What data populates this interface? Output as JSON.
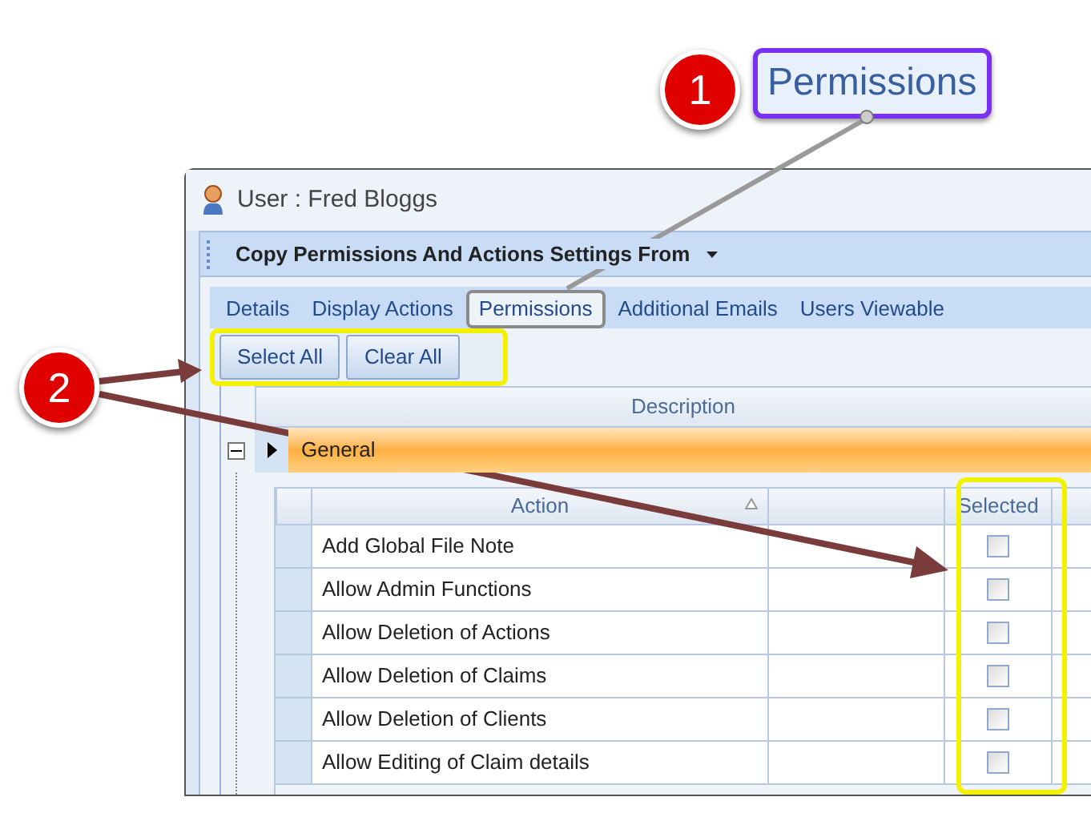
{
  "annotations": {
    "callouts": [
      {
        "number": "1"
      },
      {
        "number": "2"
      }
    ],
    "zoomed_label": "Permissions"
  },
  "window": {
    "title": "User : Fred Bloggs"
  },
  "toolbar": {
    "label": "Copy Permissions And Actions Settings From"
  },
  "tabs": [
    {
      "label": "Details",
      "selected": false
    },
    {
      "label": "Display Actions",
      "selected": false
    },
    {
      "label": "Permissions",
      "selected": true
    },
    {
      "label": "Additional Emails",
      "selected": false
    },
    {
      "label": "Users Viewable",
      "selected": false
    }
  ],
  "buttons": [
    "Select All",
    "Clear All"
  ],
  "grid": {
    "column": "Description",
    "group": {
      "label": "General",
      "expanded": true
    }
  },
  "actions_table": {
    "action_header": "Action",
    "selected_header": "Selected",
    "rows": [
      {
        "action": "Add Global File Note",
        "checked": false
      },
      {
        "action": "Allow Admin Functions",
        "checked": false
      },
      {
        "action": "Allow Deletion of Actions",
        "checked": false
      },
      {
        "action": "Allow Deletion of Claims",
        "checked": false
      },
      {
        "action": "Allow Deletion of Clients",
        "checked": false
      },
      {
        "action": "Allow Editing of Claim details",
        "checked": false
      }
    ]
  }
}
